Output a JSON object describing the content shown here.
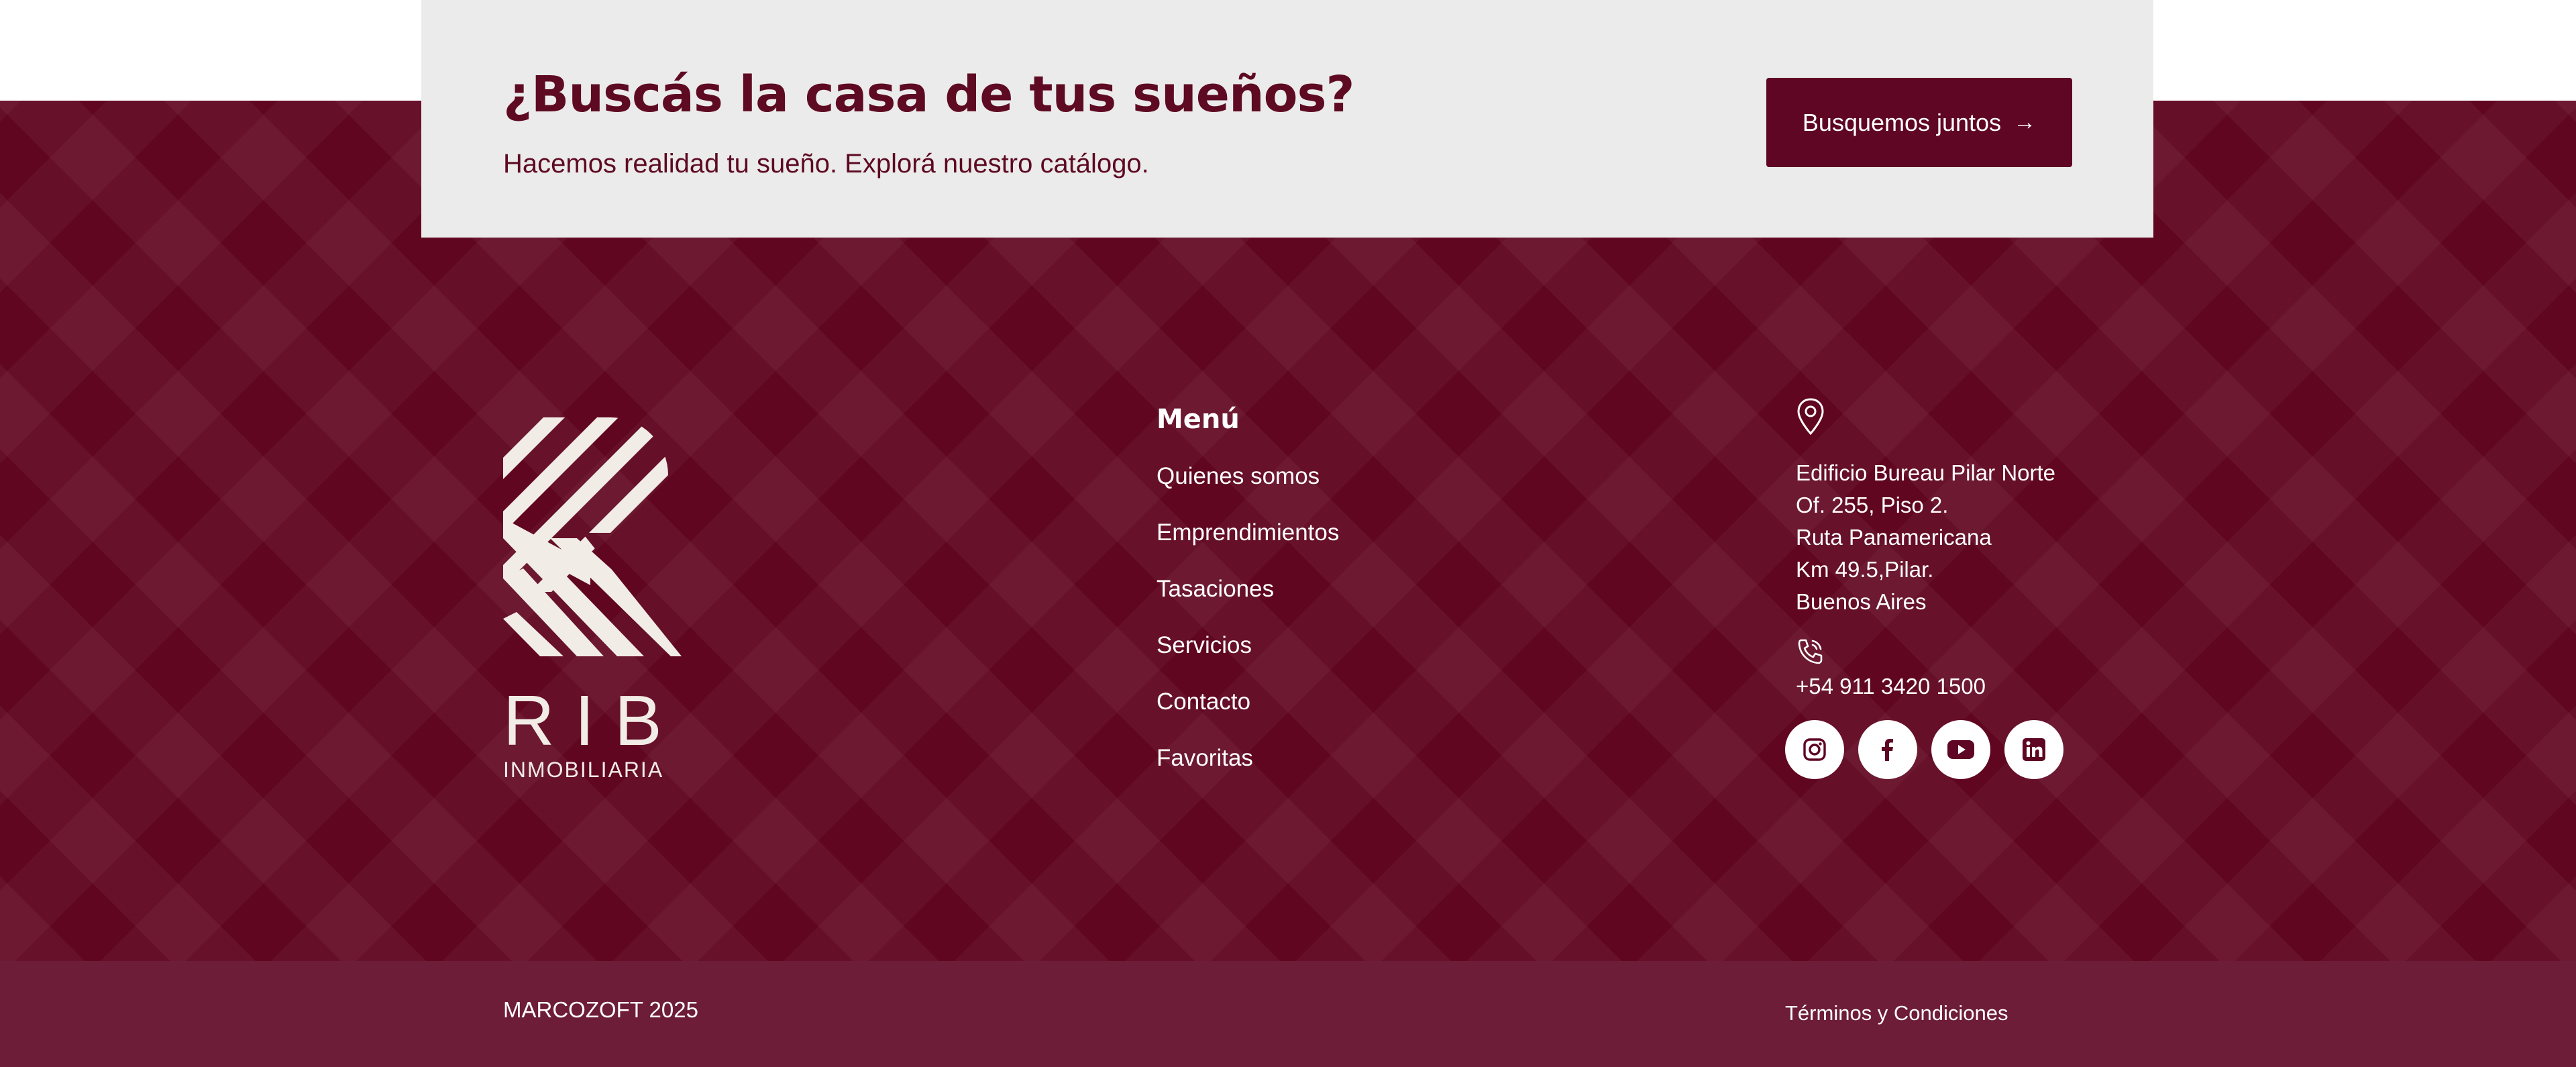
{
  "cta": {
    "title": "¿Buscás la casa de tus sueños?",
    "subtitle": "Hacemos realidad tu sueño. Explorá nuestro catálogo.",
    "button_label": "Busquemos juntos",
    "button_arrow": "→"
  },
  "logo": {
    "word": "RIB",
    "sub": "INMOBILIARIA"
  },
  "menu": {
    "title": "Menú",
    "items": [
      {
        "label": "Quienes somos"
      },
      {
        "label": "Emprendimientos"
      },
      {
        "label": "Tasaciones"
      },
      {
        "label": "Servicios"
      },
      {
        "label": "Contacto"
      },
      {
        "label": "Favoritas"
      }
    ]
  },
  "contact": {
    "address_lines": [
      "Edificio Bureau Pilar Norte",
      "Of. 255, Piso 2.",
      "Ruta Panamericana",
      "Km 49.5,Pilar.",
      "Buenos Aires"
    ],
    "phone": "+54 911 3420 1500",
    "socials": [
      {
        "icon": "instagram-icon"
      },
      {
        "icon": "facebook-icon"
      },
      {
        "icon": "youtube-icon"
      },
      {
        "icon": "linkedin-icon"
      }
    ]
  },
  "bottom": {
    "copyright": "MARCOZOFT 2025",
    "terms": "Términos y Condiciones"
  },
  "colors": {
    "brand": "#600620",
    "bottom_bar": "#6d1d38",
    "cta_bg": "#ebebeb",
    "logo": "#f2ece6"
  }
}
